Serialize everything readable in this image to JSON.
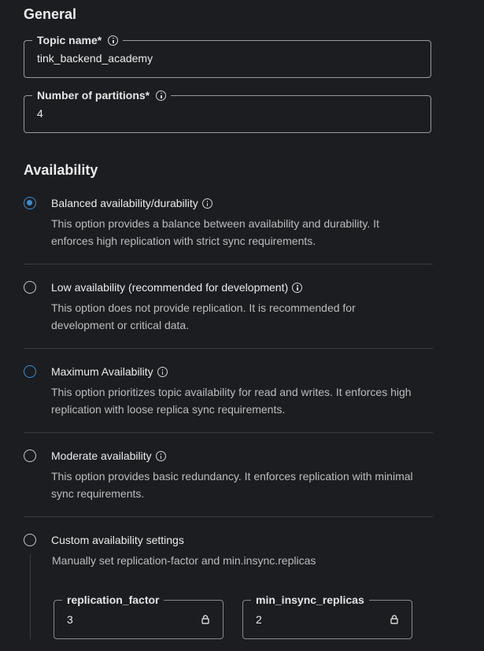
{
  "general": {
    "title": "General",
    "topic_name": {
      "label": "Topic name*",
      "value": "tink_backend_academy"
    },
    "partitions": {
      "label": "Number of partitions*",
      "value": "4"
    }
  },
  "availability": {
    "title": "Availability",
    "options": [
      {
        "title": "Balanced availability/durability",
        "description": "This option provides a balance between availability and durability. It enforces high replication with strict sync requirements.",
        "selected": true
      },
      {
        "title": "Low availability (recommended for development)",
        "description": "This option does not provide replication. It is recommended for development or critical data.",
        "selected": false
      },
      {
        "title": "Maximum Availability",
        "description": "This option prioritizes topic availability for read and writes. It enforces high replication with loose replica sync requirements.",
        "selected": false
      },
      {
        "title": "Moderate availability",
        "description": "This option provides basic redundancy. It enforces replication with minimal sync requirements.",
        "selected": false
      },
      {
        "title": "Custom availability settings",
        "description": "Manually set replication-factor and min.insync.replicas",
        "selected": false
      }
    ],
    "custom": {
      "replication_factor": {
        "label": "replication_factor",
        "value": "3"
      },
      "min_insync_replicas": {
        "label": "min_insync_replicas",
        "value": "2"
      }
    }
  },
  "colors": {
    "background": "#1c1d20",
    "accent": "#3b8fd1",
    "border": "#9a9a9a",
    "divider": "#3a3b3f"
  }
}
